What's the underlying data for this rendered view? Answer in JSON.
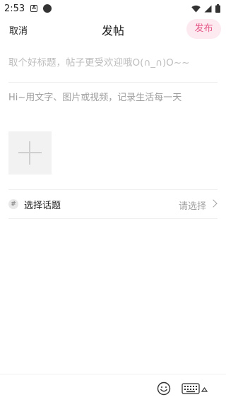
{
  "status_bar": {
    "time": "2:53",
    "notification_glyph": "A",
    "icons": [
      "notification-a-icon",
      "circle-dot-icon",
      "wifi-icon",
      "signal-icon",
      "battery-icon"
    ]
  },
  "nav": {
    "cancel_label": "取消",
    "title": "发帖",
    "publish_label": "发布"
  },
  "post": {
    "title_placeholder": "取个好标题，帖子更受欢迎哦O(∩_∩)O~~",
    "body_placeholder": "Hi~用文字、图片或视频，记录生活每一天",
    "add_media_icon": "plus-icon"
  },
  "topic": {
    "hash_glyph": "#",
    "label": "选择话题",
    "value": "请选择"
  },
  "toolbar": {
    "icons": [
      "emoji-icon",
      "keyboard-icon",
      "caret-up-icon"
    ]
  },
  "colors": {
    "accent": "#e65a8a",
    "accent_bg": "#fde9f0",
    "placeholder": "#bdbdbd",
    "divider": "#eeeeee"
  }
}
